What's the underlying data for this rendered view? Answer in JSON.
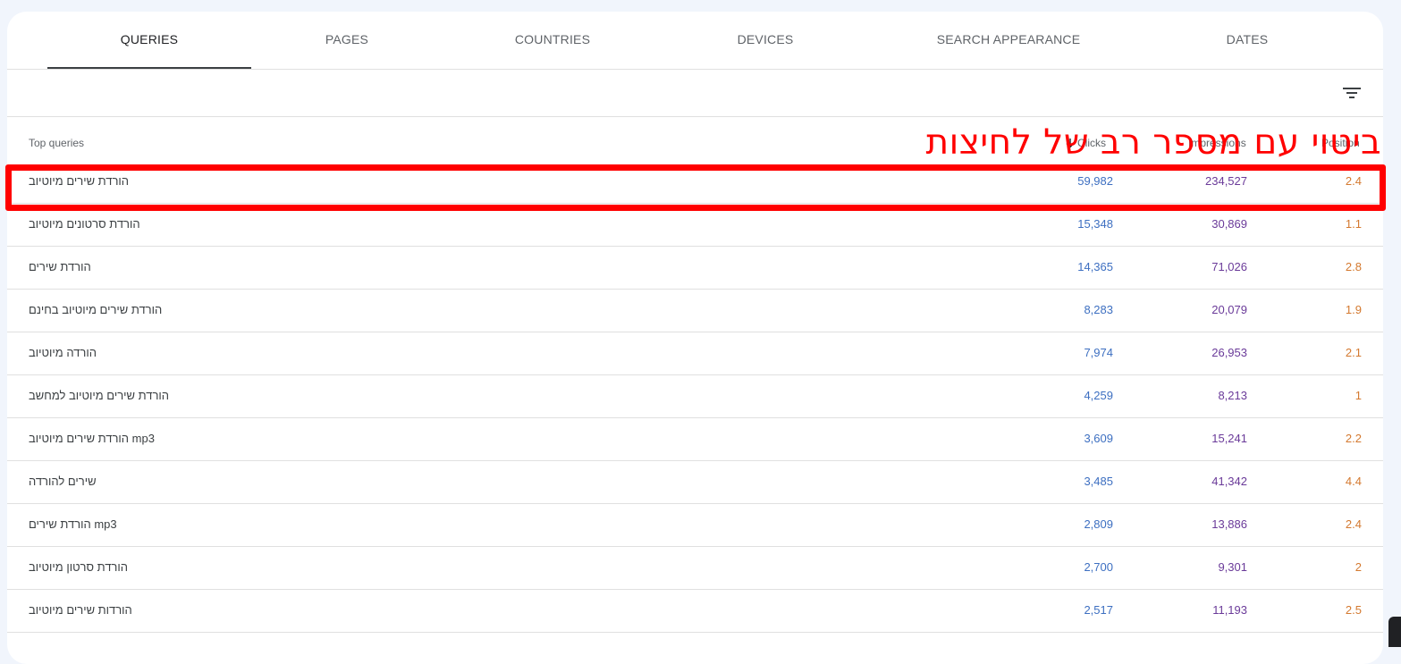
{
  "tabs": [
    {
      "label": "QUERIES",
      "active": true
    },
    {
      "label": "PAGES",
      "active": false
    },
    {
      "label": "COUNTRIES",
      "active": false
    },
    {
      "label": "DEVICES",
      "active": false
    },
    {
      "label": "SEARCH APPEARANCE",
      "active": false
    },
    {
      "label": "DATES",
      "active": false
    }
  ],
  "toolbar": {
    "filter_icon": "filter-icon"
  },
  "table": {
    "headers": {
      "query": "Top queries",
      "clicks": "Clicks",
      "impressions": "Impressions",
      "position": "Position"
    },
    "sort_icon": "arrow-down-icon",
    "rows": [
      {
        "query": "הורדת שירים מיוטיוב",
        "clicks": "59,982",
        "impressions": "234,527",
        "position": "2.4"
      },
      {
        "query": "הורדת סרטונים מיוטיוב",
        "clicks": "15,348",
        "impressions": "30,869",
        "position": "1.1"
      },
      {
        "query": "הורדת שירים",
        "clicks": "14,365",
        "impressions": "71,026",
        "position": "2.8"
      },
      {
        "query": "הורדת שירים מיוטיוב בחינם",
        "clicks": "8,283",
        "impressions": "20,079",
        "position": "1.9"
      },
      {
        "query": "הורדה מיוטיוב",
        "clicks": "7,974",
        "impressions": "26,953",
        "position": "2.1"
      },
      {
        "query": "הורדת שירים מיוטיוב למחשב",
        "clicks": "4,259",
        "impressions": "8,213",
        "position": "1"
      },
      {
        "query": "הורדת שירים מיוטיוב mp3",
        "clicks": "3,609",
        "impressions": "15,241",
        "position": "2.2"
      },
      {
        "query": "שירים להורדה",
        "clicks": "3,485",
        "impressions": "41,342",
        "position": "4.4"
      },
      {
        "query": "הורדת שירים mp3",
        "clicks": "2,809",
        "impressions": "13,886",
        "position": "2.4"
      },
      {
        "query": "הורדת סרטון מיוטיוב",
        "clicks": "2,700",
        "impressions": "9,301",
        "position": "2"
      },
      {
        "query": "הורדות שירים מיוטיוב",
        "clicks": "2,517",
        "impressions": "11,193",
        "position": "2.5"
      }
    ]
  },
  "annotation": {
    "text": "ביטוי עם מספר רב של לחיצות",
    "color": "#ff0000"
  },
  "colors": {
    "clicks": "#3d6fc1",
    "impressions": "#6a3a99",
    "position": "#d4792f"
  }
}
